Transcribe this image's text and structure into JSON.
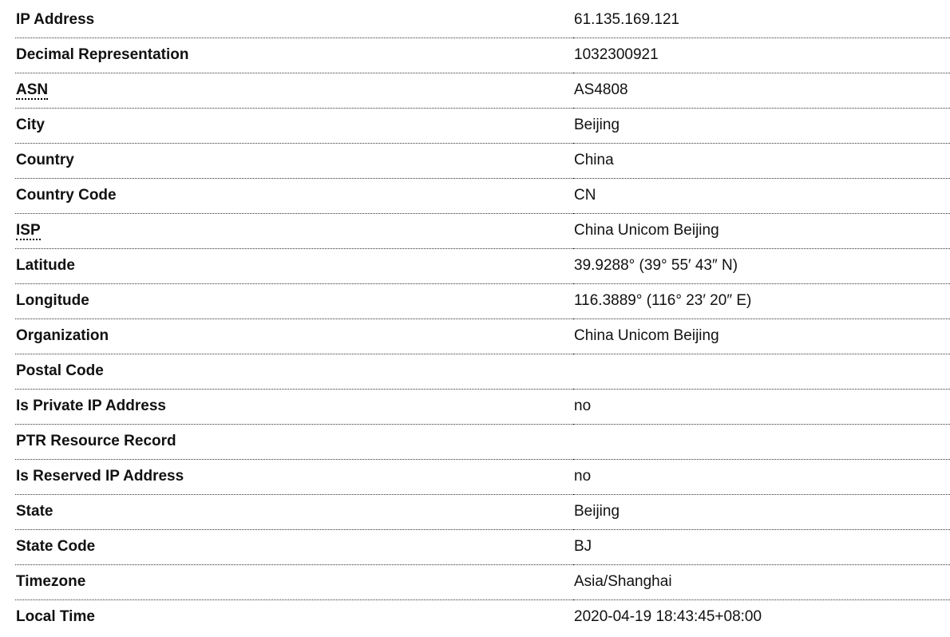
{
  "rows": [
    {
      "label": "IP Address",
      "value": "61.135.169.121"
    },
    {
      "label": "Decimal Representation",
      "value": "1032300921"
    },
    {
      "label": "ASN",
      "value": "AS4808",
      "abbr": true
    },
    {
      "label": "City",
      "value": "Beijing"
    },
    {
      "label": "Country",
      "value": "China"
    },
    {
      "label": "Country Code",
      "value": "CN"
    },
    {
      "label": "ISP",
      "value": "China Unicom Beijing",
      "abbr": true
    },
    {
      "label": "Latitude",
      "value": "39.9288° (39° 55′ 43″ N)"
    },
    {
      "label": "Longitude",
      "value": "116.3889° (116° 23′ 20″ E)"
    },
    {
      "label": "Organization",
      "value": "China Unicom Beijing"
    },
    {
      "label": "Postal Code",
      "value": ""
    },
    {
      "label": "Is Private IP Address",
      "value": "no"
    },
    {
      "label": "PTR Resource Record",
      "value": ""
    },
    {
      "label": "Is Reserved IP Address",
      "value": "no"
    },
    {
      "label": "State",
      "value": "Beijing"
    },
    {
      "label": "State Code",
      "value": "BJ"
    },
    {
      "label": "Timezone",
      "value": "Asia/Shanghai"
    },
    {
      "label": "Local Time",
      "value": "2020-04-19 18:43:45+08:00"
    }
  ]
}
